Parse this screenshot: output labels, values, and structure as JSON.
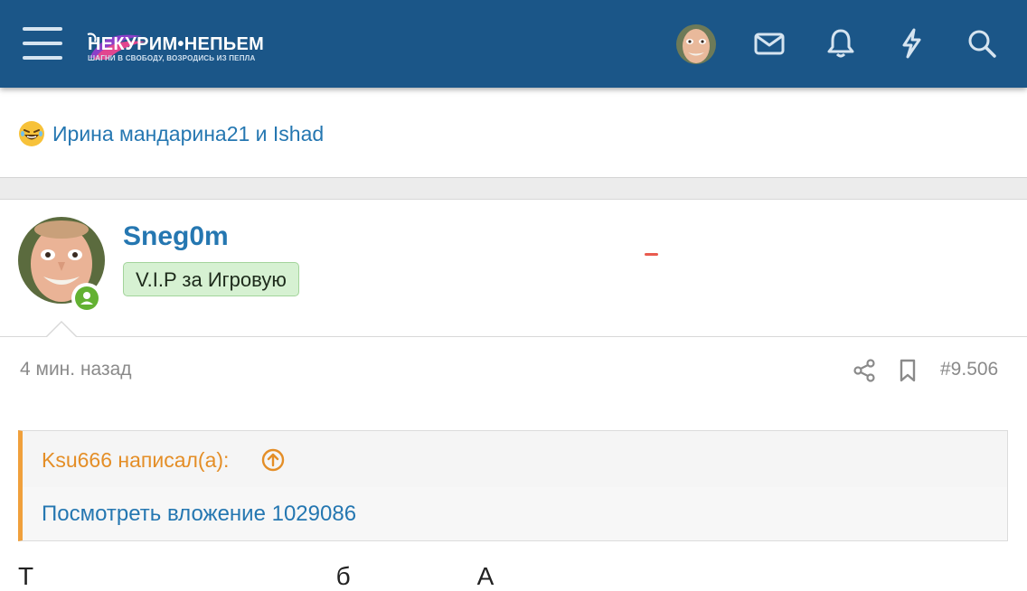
{
  "header": {
    "logo": {
      "name": "НЕКУРИМ•НЕПЬЕМ",
      "tagline": "ШАГНИ В СВОБОДУ, ВОЗРОДИСЬ ИЗ ПЕПЛА"
    },
    "icons": [
      "menu-icon",
      "envelope-icon",
      "bell-icon",
      "lightning-icon",
      "search-icon"
    ],
    "colors": {
      "bar": "#1b5688",
      "icon": "#d6e4f0"
    }
  },
  "reactions": {
    "text": "Ирина мандарина21 и Ishad",
    "emoji": "laughing-emoji-icon"
  },
  "post": {
    "username": "Sneg0m",
    "badge": "V.I.P за Игровую",
    "time": "4 мин. назад",
    "number": "#9.506",
    "quote": {
      "author": "Ksu666 написал(а):",
      "link": "Посмотреть вложение 1029086"
    },
    "text": "Т                                           б                  А"
  }
}
